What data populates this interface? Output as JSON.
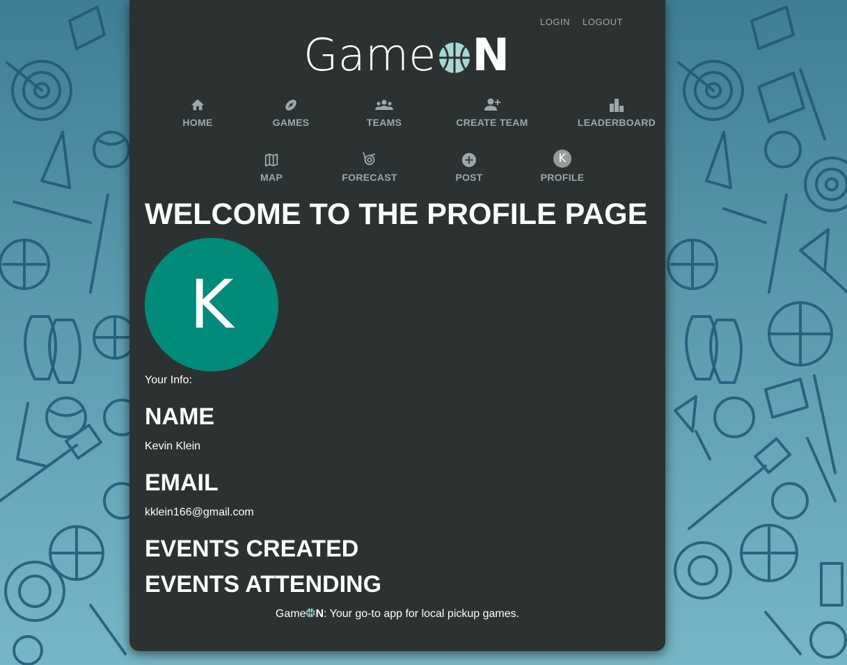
{
  "brand": {
    "logo_prefix": "Game",
    "logo_suffix": "N",
    "accent_color": "#a8d8d4",
    "tagline": ": Your go-to app for local pickup games."
  },
  "auth": {
    "login": "LOGIN",
    "logout": "LOGOUT"
  },
  "nav": [
    {
      "label": "HOME",
      "icon": "home-icon"
    },
    {
      "label": "GAMES",
      "icon": "football-icon"
    },
    {
      "label": "TEAMS",
      "icon": "group-icon"
    },
    {
      "label": "CREATE TEAM",
      "icon": "person-add-icon"
    },
    {
      "label": "LEADERBOARD",
      "icon": "bar-chart-icon"
    },
    {
      "label": "MAP",
      "icon": "map-icon"
    },
    {
      "label": "FORECAST",
      "icon": "cyclone-icon"
    },
    {
      "label": "POST",
      "icon": "add-circle-icon"
    },
    {
      "label": "PROFILE",
      "icon": "avatar-icon",
      "avatar_letter": "K"
    }
  ],
  "profile": {
    "heading": "WELCOME TO THE PROFILE PAGE",
    "avatar_letter": "K",
    "avatar_color": "#008b7a",
    "info_label": "Your Info:",
    "name_heading": "NAME",
    "name": "Kevin Klein",
    "email_heading": "EMAIL",
    "email": "kklein166@gmail.com",
    "events_created_heading": "EVENTS CREATED",
    "events_attending_heading": "EVENTS ATTENDING"
  }
}
